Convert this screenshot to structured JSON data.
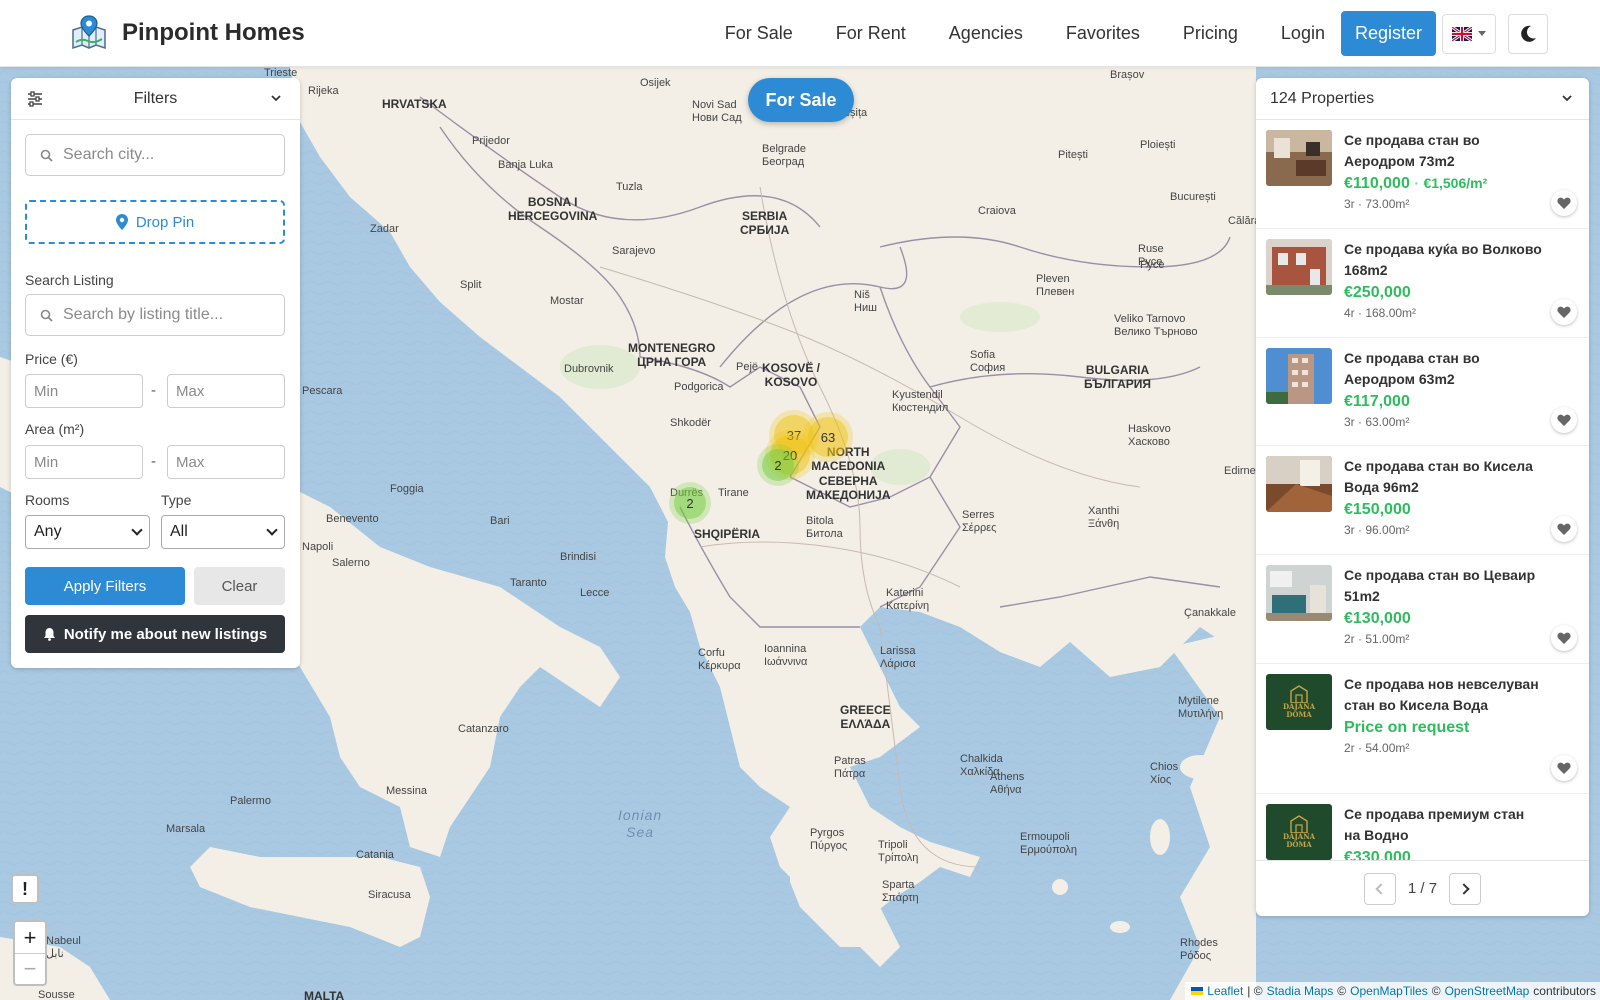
{
  "header": {
    "brand": "Pinpoint Homes",
    "nav": [
      "For Sale",
      "For Rent",
      "Agencies",
      "Favorites",
      "Pricing",
      "Login"
    ],
    "register": "Register"
  },
  "map": {
    "mode_pill": "For Sale",
    "clusters": [
      {
        "label": "37",
        "color": "yellow"
      },
      {
        "label": "63",
        "color": "yellow"
      },
      {
        "label": "20",
        "color": "yellow"
      },
      {
        "label": "2",
        "color": "green"
      },
      {
        "label": "2",
        "color": "green"
      }
    ],
    "labels": {
      "hrvatska": "HRVATSKA",
      "bih": "BOSNA I\nHERCEGOVINA",
      "serbia": "SERBIA\nСРБИЈА",
      "montenegro": "MONTENEGRO\nЦРНА ГОРА",
      "kosovo": "KOSOVË /\nKOSOVO",
      "macedonia": "NORTH\nMACEDONIA\nСЕВЕРНА\nМАКЕДОНИЈА",
      "albania": "SHQIPËRIA",
      "bulgaria": "BULGARIA\nБЪЛГАРИЯ",
      "greece": "GREECE\nΕΛΛΆΔΑ",
      "malta": "MALTA",
      "ionian": "Ionian\nSea",
      "cities": [
        "Novi Sad\nНови Сад",
        "Belgrade\nБеоград",
        "Sarajevo",
        "Split",
        "Mostar",
        "Dubrovnik",
        "Podgorica",
        "Shkodër",
        "Pejë",
        "Niš\nНиш",
        "Sofia\nСофия",
        "Kyustendil\nКюстендил",
        "Tirane",
        "Durrës",
        "Bitola\nБитола",
        "Serres\nΣέρρες",
        "Xanthi\nΞάνθη",
        "Katerini\nΚατερίνη",
        "Larissa\nΛάρισα",
        "Ioannina\nΙωάννινα",
        "Corfu\nΚέρκυρα",
        "Patras\nΠάτρα",
        "Athens\nΑθήνα",
        "Chalkida\nΧαλκίδα",
        "Tripoli\nΤρίπολη",
        "Sparta\nΣπάρτη",
        "Pyrgos\nΠύργος",
        "Osijek",
        "Pitești",
        "Ploiești",
        "Brașov",
        "București",
        "Craiova",
        "Ruse\nРусе",
        "Pleven\nПлевен",
        "Veliko Tarnovo\nВелико Търново",
        "Haskovo\nХасково",
        "Edirne",
        "Mytilene\nΜυτιλήνη",
        "Chios\nΧίος",
        "Ermoupoli\nΕρμούπολη",
        "Rhodes\nΡόδος",
        "Çanakkale",
        "Prijedor",
        "Banja Luka",
        "Tuzla",
        "Zadar",
        "Foggia",
        "Bari",
        "Brindisi",
        "Taranto",
        "Lecce",
        "Benevento",
        "Napoli",
        "Salerno",
        "Pescara",
        "Catanzaro",
        "Messina",
        "Palermo",
        "Marsala",
        "Catania",
        "Siracusa",
        "Nabeul\nنابل",
        "Sousse",
        "Trieste",
        "Rijeka",
        "Reșița",
        "Pyce",
        "Călăra"
      ]
    },
    "attribution": {
      "leaflet": "Leaflet",
      "stadia": "Stadia Maps",
      "omt": "OpenMapTiles",
      "osm": "OpenStreetMap",
      "sep1": "| ©",
      "sep2": "©",
      "sep3": "©",
      "tail": "contributors"
    }
  },
  "filters": {
    "title": "Filters",
    "city_placeholder": "Search city...",
    "drop_pin": "Drop Pin",
    "search_listing_label": "Search Listing",
    "listing_placeholder": "Search by listing title...",
    "price_label": "Price (€)",
    "area_label": "Area (m²)",
    "min": "Min",
    "max": "Max",
    "dash": "-",
    "rooms_label": "Rooms",
    "rooms_value": "Any",
    "type_label": "Type",
    "type_value": "All",
    "apply": "Apply Filters",
    "clear": "Clear",
    "notify": "Notify me about new listings"
  },
  "properties": {
    "count_label": "124 Properties",
    "items": [
      {
        "title": "Се продава стан во Аеродром 73m2",
        "price": "€110,000",
        "ppm": "€1,506/m²",
        "meta": "3r · 73.00m²"
      },
      {
        "title": "Се продава куќа во Волково 168m2",
        "price": "€250,000",
        "ppm": "",
        "meta": "4r · 168.00m²"
      },
      {
        "title": "Се продава стан во Аеродром 63m2",
        "price": "€117,000",
        "ppm": "",
        "meta": "3r · 63.00m²"
      },
      {
        "title": "Се продава стан во Кисела Вода 96m2",
        "price": "€150,000",
        "ppm": "",
        "meta": "3r · 96.00m²"
      },
      {
        "title": "Се продава стан во Цеваир 51m2",
        "price": "€130,000",
        "ppm": "",
        "meta": "2r · 51.00m²"
      },
      {
        "title": "Се продава нов невселуван стан во Кисела Вода",
        "price": "Price on request",
        "ppm": "",
        "meta": "2r · 54.00m²"
      },
      {
        "title": "Се продава премиум стан на Водно",
        "price": "€330,000",
        "ppm": "",
        "meta": ""
      }
    ],
    "logo_text": "DAJANA\nDOMA",
    "page": "1 / 7",
    "price_sep": "·"
  },
  "misc": {
    "zoom_in": "+",
    "zoom_out": "−",
    "alert": "!"
  },
  "colors": {
    "accent": "#2d8bd6",
    "price": "#2ebd5c",
    "dark": "#2f353b"
  }
}
